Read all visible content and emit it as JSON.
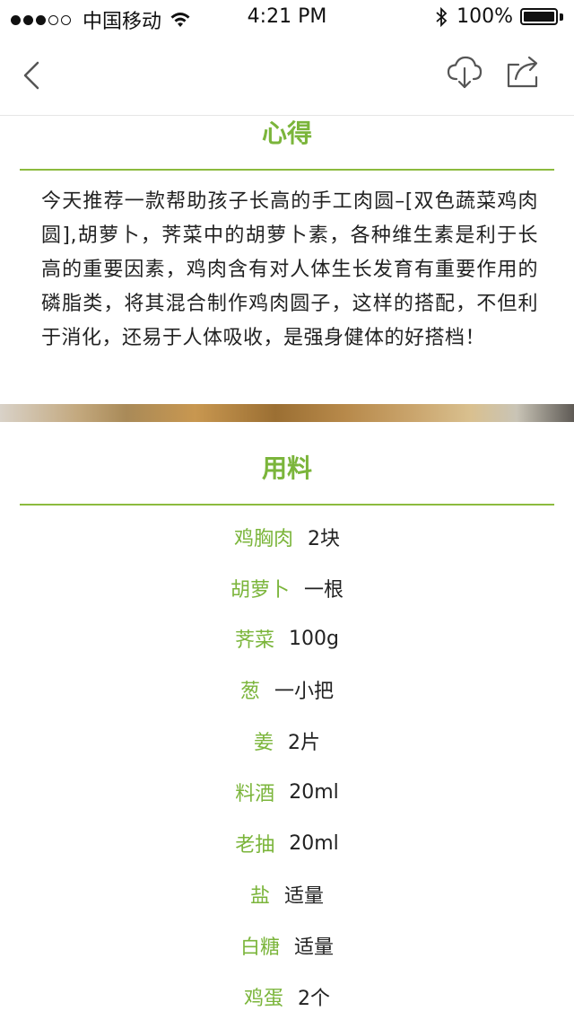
{
  "status_bar": {
    "carrier": "中国移动",
    "time": "4:21 PM",
    "battery": "100%"
  },
  "nav": {
    "back_icon": "chevron-left-icon",
    "download_icon": "cloud-download-icon",
    "share_icon": "share-icon"
  },
  "tips": {
    "title": "心得",
    "body": "今天推荐一款帮助孩子长高的手工肉圆–[双色蔬菜鸡肉圆],胡萝卜，荠菜中的胡萝卜素，各种维生素是利于长高的重要因素，鸡肉含有对人体生长发育有重要作用的磷脂类，将其混合制作鸡肉圆子，这样的搭配，不但利于消化，还易于人体吸收，是强身健体的好搭档！"
  },
  "ingredients": {
    "title": "用料",
    "items": [
      {
        "name": "鸡胸肉",
        "amount": "2块"
      },
      {
        "name": "胡萝卜",
        "amount": "一根"
      },
      {
        "name": "荠菜",
        "amount": "100g"
      },
      {
        "name": "葱",
        "amount": "一小把"
      },
      {
        "name": "姜",
        "amount": "2片"
      },
      {
        "name": "料酒",
        "amount": "20ml"
      },
      {
        "name": "老抽",
        "amount": "20ml"
      },
      {
        "name": "盐",
        "amount": "适量"
      },
      {
        "name": "白糖",
        "amount": "适量"
      },
      {
        "name": "鸡蛋",
        "amount": "2个"
      }
    ]
  },
  "colors": {
    "accent": "#7bb53b",
    "rule": "#8cbb3e",
    "text": "#222222"
  }
}
